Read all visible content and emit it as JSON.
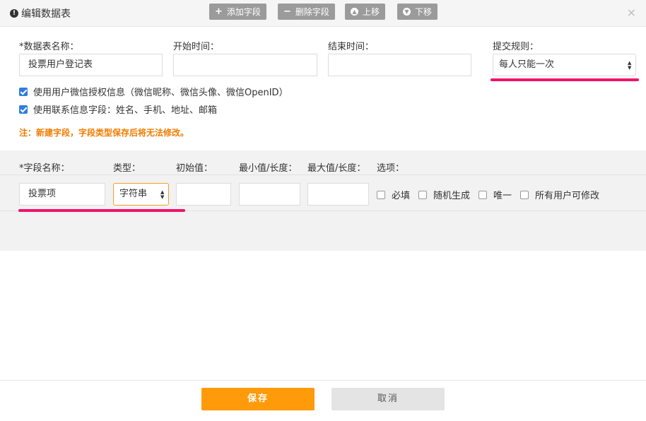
{
  "header": {
    "title": "编辑数据表",
    "icon": "alert-icon",
    "toolbar": {
      "add_field": "添加字段",
      "delete_field": "删除字段",
      "move_up": "上移",
      "move_down": "下移"
    },
    "close_symbol": "×"
  },
  "form": {
    "table_name_label": "*数据表名称：",
    "table_name_value": "投票用户登记表",
    "start_time_label": "开始时间：",
    "start_time_value": "",
    "end_time_label": "结束时间：",
    "end_time_value": "",
    "submit_rule_label": "提交规则：",
    "submit_rule_value": "每人只能一次",
    "checkboxes": [
      {
        "label": "使用用户微信授权信息（微信昵称、微信头像、微信OpenID）",
        "checked": true
      },
      {
        "label": "使用联系信息字段：姓名、手机、地址、邮箱",
        "checked": true
      }
    ],
    "note": "注：新建字段，字段类型保存后将无法修改。"
  },
  "fields_table": {
    "headers": {
      "name": "*字段名称：",
      "type": "类型：",
      "initial": "初始值：",
      "min": "最小值/长度：",
      "max": "最大值/长度：",
      "options": "选项："
    },
    "row": {
      "name": "投票项",
      "type": "字符串",
      "initial": "",
      "min": "",
      "max": "",
      "options": [
        {
          "label": "必填",
          "checked": false
        },
        {
          "label": "随机生成",
          "checked": false
        },
        {
          "label": "唯一",
          "checked": false
        },
        {
          "label": "所有用户可修改",
          "checked": false
        }
      ]
    }
  },
  "footer": {
    "save": "保存",
    "cancel": "取消"
  },
  "colors": {
    "accent_orange": "#ff9a0a",
    "note_orange": "#f07c00",
    "highlight_pink": "#f0136b",
    "checkbox_blue": "#2f7de1"
  }
}
